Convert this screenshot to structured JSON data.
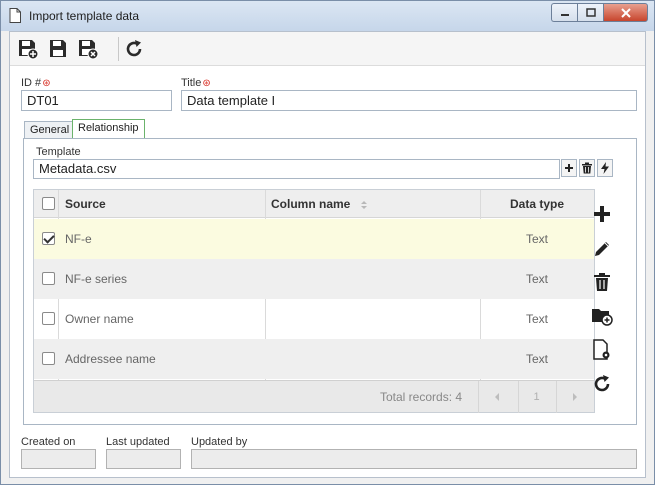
{
  "window": {
    "title": "Import template data",
    "minimize_icon": "minimize-icon",
    "maximize_icon": "maximize-icon",
    "close_icon": "close-icon"
  },
  "toolbar": {
    "buttons": [
      "save-new-icon",
      "save-icon",
      "save-close-icon",
      "refresh-icon"
    ]
  },
  "form": {
    "id_label": "ID #",
    "id_value": "DT01",
    "title_label": "Title",
    "title_value": "Data template I"
  },
  "tabs": [
    {
      "label": "General",
      "active": false
    },
    {
      "label": "Relationship",
      "active": true
    }
  ],
  "template": {
    "label": "Template",
    "value": "Metadata.csv"
  },
  "grid": {
    "columns": [
      "Source",
      "Column name",
      "Data type"
    ],
    "rows": [
      {
        "source": "NF-e",
        "column_name": "",
        "data_type": "Text",
        "checked": true
      },
      {
        "source": "NF-e series",
        "column_name": "",
        "data_type": "Text",
        "checked": false
      },
      {
        "source": "Owner name",
        "column_name": "",
        "data_type": "Text",
        "checked": false
      },
      {
        "source": "Addressee name",
        "column_name": "",
        "data_type": "Text",
        "checked": false
      }
    ],
    "total_records": "Total records: 4",
    "page": "1"
  },
  "side_tools": [
    "add-icon",
    "edit-icon",
    "delete-icon",
    "folder-add-icon",
    "document-settings-icon",
    "refresh-icon"
  ],
  "footer": {
    "created_on_label": "Created on",
    "created_on_value": "",
    "last_updated_label": "Last updated",
    "last_updated_value": "",
    "updated_by_label": "Updated by",
    "updated_by_value": ""
  },
  "colors": {
    "selected_row": "#fbfbe0",
    "required_marker": "#d93025",
    "active_tab_border": "#6bb36b"
  }
}
